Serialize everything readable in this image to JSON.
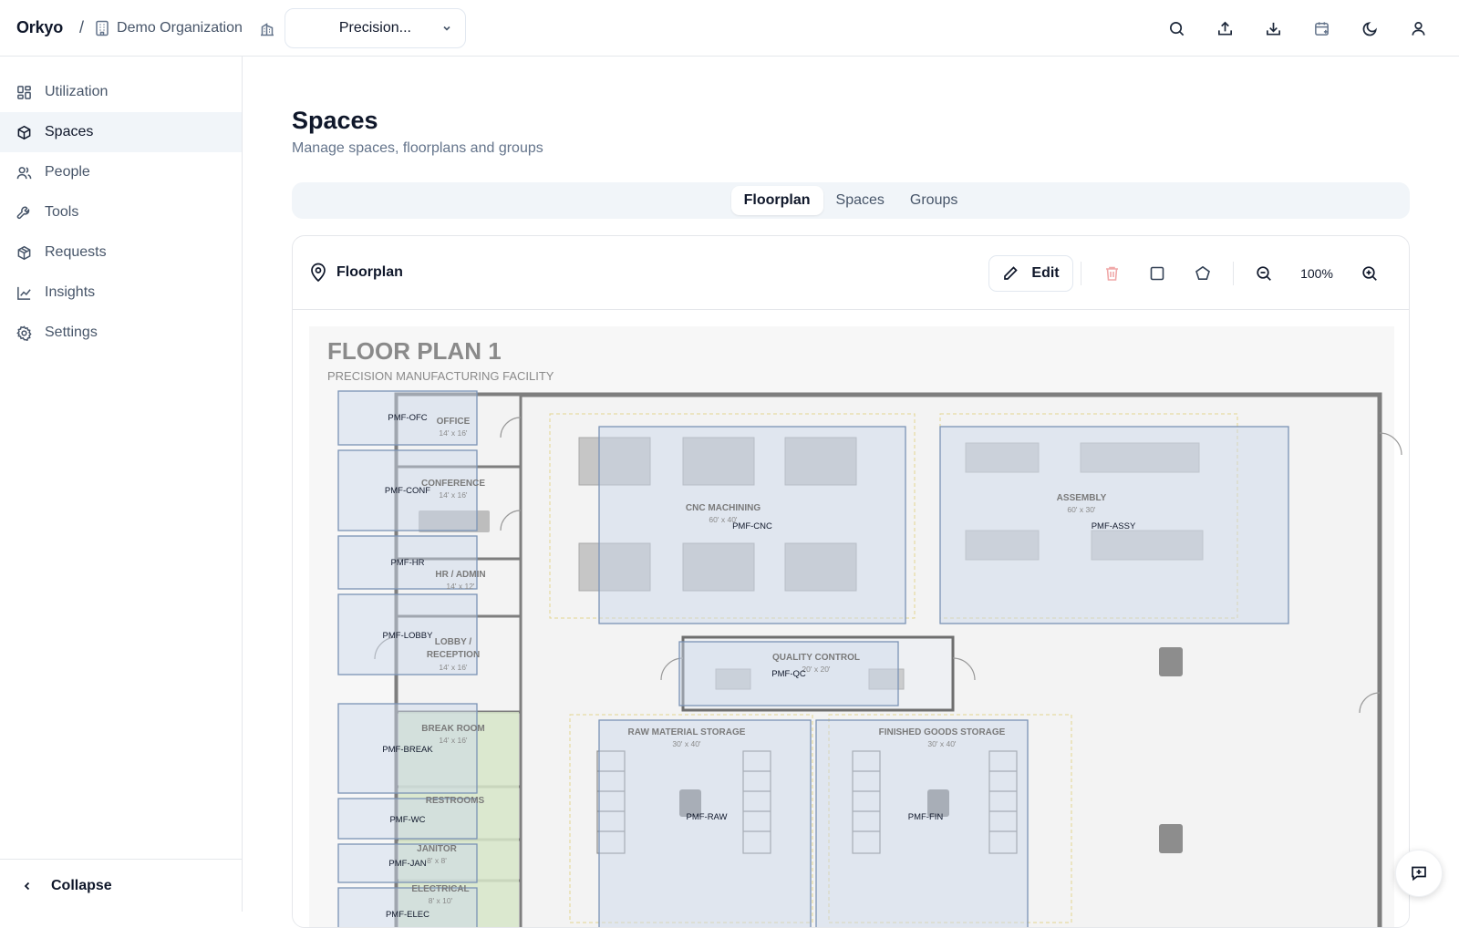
{
  "header": {
    "brand": "Orkyo",
    "separator": "/",
    "organization": "Demo Organization",
    "site_selector": "Precision...",
    "actions": [
      "search-icon",
      "upload-icon",
      "download-icon",
      "calendar-icon",
      "moon-icon",
      "user-icon"
    ]
  },
  "sidebar": {
    "items": [
      {
        "label": "Utilization",
        "icon": "grid-icon"
      },
      {
        "label": "Spaces",
        "icon": "cube-icon",
        "active": true
      },
      {
        "label": "People",
        "icon": "users-icon"
      },
      {
        "label": "Tools",
        "icon": "wrench-icon"
      },
      {
        "label": "Requests",
        "icon": "package-icon"
      },
      {
        "label": "Insights",
        "icon": "chart-icon"
      },
      {
        "label": "Settings",
        "icon": "gear-icon"
      }
    ],
    "collapse_label": "Collapse"
  },
  "page": {
    "title": "Spaces",
    "subtitle": "Manage spaces, floorplans and groups"
  },
  "tabs": [
    "Floorplan",
    "Spaces",
    "Groups"
  ],
  "active_tab": "Floorplan",
  "card": {
    "title": "Floorplan",
    "edit_label": "Edit",
    "zoom": "100%"
  },
  "floorplan": {
    "title": "FLOOR PLAN 1",
    "subtitle": "PRECISION MANUFACTURING FACILITY",
    "rooms": [
      {
        "name": "OFFICE",
        "size": "14' x 16'"
      },
      {
        "name": "CONFERENCE",
        "size": "14' x 16'"
      },
      {
        "name": "HR / ADMIN",
        "size": "14' x 12'"
      },
      {
        "name": "LOBBY /",
        "name2": "RECEPTION",
        "size": "14' x 16'"
      },
      {
        "name": "BREAK ROOM",
        "size": "14' x 16'"
      },
      {
        "name": "RESTROOMS",
        "size": ""
      },
      {
        "name": "JANITOR",
        "size": "8' x 8'"
      },
      {
        "name": "ELECTRICAL",
        "size": "8' x 10'"
      },
      {
        "name": "CNC MACHINING",
        "size": "60' x 40'"
      },
      {
        "name": "ASSEMBLY",
        "size": "60' x 30'"
      },
      {
        "name": "QUALITY CONTROL",
        "size": "20' x 20'"
      },
      {
        "name": "RAW MATERIAL STORAGE",
        "size": "30' x 40'"
      },
      {
        "name": "FINISHED GOODS STORAGE",
        "size": "30' x 40'"
      }
    ],
    "space_codes": [
      "PMF-OFC",
      "PMF-CONF",
      "PMF-HR",
      "PMF-LOBBY",
      "PMF-BREAK",
      "PMF-WC",
      "PMF-JAN",
      "PMF-ELEC",
      "PMF-CNC",
      "PMF-ASSY",
      "PMF-QC",
      "PMF-RAW",
      "PMF-FIN"
    ]
  },
  "colors": {
    "accent": "#0f172a",
    "muted": "#64748b",
    "space_fill": "#c9d8ec",
    "space_stroke": "#7b93b5",
    "break_fill": "#d3e6c2"
  }
}
